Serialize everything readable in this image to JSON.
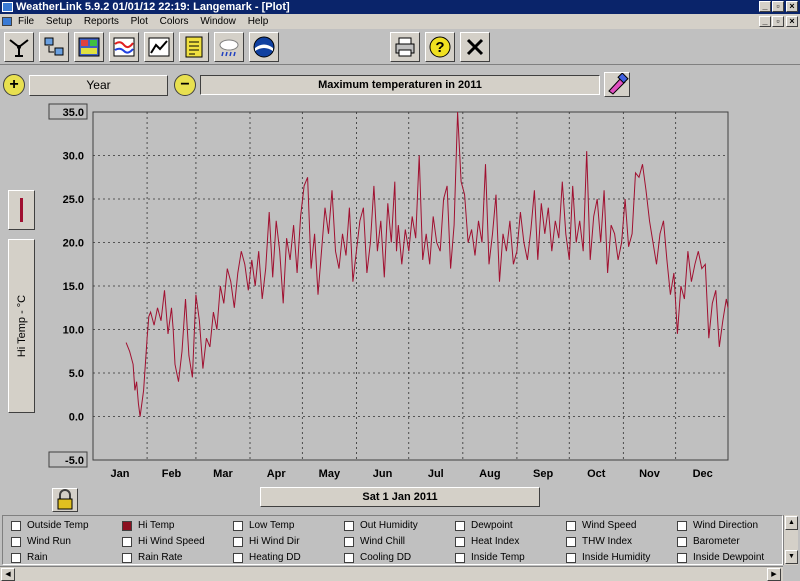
{
  "window": {
    "title": "WeatherLink 5.9.2  01/01/12  22:19: Langemark - [Plot]"
  },
  "menu": {
    "items": [
      "File",
      "Setup",
      "Reports",
      "Plot",
      "Colors",
      "Window",
      "Help"
    ]
  },
  "toolbar": {
    "icons": [
      "station-icon",
      "transfer-icon",
      "bulletin-icon",
      "strip-chart-icon",
      "plot-icon",
      "notes-icon",
      "forecast-icon",
      "noaa-icon",
      "print-icon",
      "help-icon",
      "close-icon"
    ]
  },
  "controls": {
    "period_label": "Year",
    "chart_title": "Maximum temperaturen in 2011",
    "axis_label": "Hi Temp - °C",
    "current_date": "Sat 1 Jan 2011"
  },
  "colors": {
    "series": "#a01030",
    "plot_bg": "#c0c0c0",
    "title_bar": "#0a246a"
  },
  "chart_data": {
    "type": "line",
    "title": "Maximum temperaturen in 2011",
    "ylabel": "Hi Temp - °C",
    "xlabel": "",
    "ylim": [
      -5,
      35
    ],
    "y_ticks": [
      "35.0",
      "30.0",
      "25.0",
      "20.0",
      "15.0",
      "10.0",
      "5.0",
      "0.0",
      "-5.0"
    ],
    "x_categories": [
      "Jan",
      "Feb",
      "Mar",
      "Apr",
      "May",
      "Jun",
      "Jul",
      "Aug",
      "Sep",
      "Oct",
      "Nov",
      "Dec"
    ],
    "grid": true,
    "series": [
      {
        "name": "Hi Temp",
        "color": "#a01030",
        "day_of_year": [
          20,
          22,
          24,
          25,
          26,
          27,
          28,
          30,
          32,
          33,
          34,
          36,
          38,
          40,
          42,
          44,
          46,
          47,
          48,
          50,
          52,
          54,
          56,
          58,
          60,
          62,
          64,
          66,
          68,
          70,
          72,
          74,
          76,
          78,
          80,
          82,
          84,
          86,
          88,
          90,
          92,
          94,
          96,
          98,
          100,
          102,
          104,
          106,
          108,
          110,
          112,
          114,
          116,
          118,
          120,
          122,
          124,
          126,
          128,
          130,
          132,
          134,
          136,
          138,
          140,
          142,
          144,
          146,
          148,
          150,
          152,
          154,
          156,
          158,
          160,
          162,
          164,
          166,
          168,
          170,
          172,
          174,
          175,
          176,
          178,
          180,
          182,
          184,
          186,
          188,
          190,
          192,
          194,
          196,
          198,
          200,
          202,
          204,
          206,
          208,
          210,
          212,
          214,
          216,
          218,
          220,
          222,
          224,
          226,
          228,
          230,
          232,
          234,
          236,
          238,
          240,
          242,
          244,
          246,
          248,
          250,
          252,
          254,
          256,
          258,
          260,
          262,
          264,
          266,
          268,
          270,
          272,
          274,
          276,
          278,
          280,
          282,
          284,
          286,
          288,
          290,
          292,
          294,
          296,
          298,
          300,
          302,
          304,
          306,
          308,
          310,
          312,
          314,
          316,
          318,
          320,
          322,
          324,
          326,
          328,
          330,
          332,
          334,
          336,
          338,
          340,
          342,
          344,
          346,
          348,
          350,
          352,
          354,
          356,
          358,
          360,
          362,
          364,
          365
        ],
        "values": [
          8.5,
          7.5,
          6,
          3,
          4,
          1.5,
          0,
          3,
          9,
          11.5,
          12,
          10.5,
          12.5,
          11,
          14.5,
          9.5,
          12.5,
          10,
          6,
          4,
          7.5,
          13.5,
          7,
          4.5,
          14,
          11,
          5.5,
          9,
          8,
          12,
          10,
          15,
          13,
          17,
          15.5,
          12.5,
          16.5,
          19,
          17.5,
          14.5,
          18,
          15,
          19,
          13.5,
          17,
          23.5,
          16,
          22.5,
          19,
          13,
          20.5,
          18,
          22,
          16.5,
          23,
          26.5,
          27.5,
          17,
          21,
          14,
          19,
          24,
          21,
          26,
          19,
          17,
          21,
          18.5,
          24,
          15.5,
          19,
          22.5,
          24,
          16.5,
          20,
          26.5,
          19,
          22.5,
          16,
          24.5,
          20,
          27,
          19,
          22,
          17.5,
          21.5,
          19,
          23,
          20.5,
          30,
          18,
          21,
          17.5,
          23,
          20,
          19,
          25,
          26.5,
          17,
          22,
          35,
          27,
          25.5,
          20,
          21.5,
          18.5,
          22.5,
          20,
          29,
          17.5,
          21,
          25.5,
          15.5,
          21,
          19,
          22.5,
          17.5,
          19,
          23.5,
          20,
          18,
          21.5,
          26,
          18,
          24.5,
          21,
          24,
          19,
          22.5,
          20.5,
          27,
          21,
          18,
          26.5,
          20,
          22.5,
          19,
          30.5,
          18,
          23,
          25,
          20,
          26,
          16.5,
          22,
          21,
          18,
          20,
          25,
          19.5,
          21,
          28,
          27.5,
          29,
          26,
          22.5,
          20,
          17.5,
          21,
          22.5,
          18,
          14,
          16.5,
          9.5,
          15,
          13.5,
          19,
          15.5,
          17.5,
          19,
          17,
          17.5,
          9,
          13,
          14.5,
          8,
          11,
          13.5,
          12.5,
          10,
          13.5,
          11,
          8.5,
          3.5,
          10,
          7.5,
          9,
          12,
          11,
          10,
          14,
          11.5,
          13,
          8.5,
          10,
          10.5,
          9,
          13,
          11,
          6,
          10.5,
          12,
          8,
          12.5,
          11,
          8.5,
          13.5,
          10,
          7.5,
          14
        ]
      }
    ]
  },
  "legend": {
    "items": [
      {
        "label": "Outside Temp",
        "checked": false
      },
      {
        "label": "Hi Temp",
        "checked": true
      },
      {
        "label": "Low Temp",
        "checked": false
      },
      {
        "label": "Out Humidity",
        "checked": false
      },
      {
        "label": "Dewpoint",
        "checked": false
      },
      {
        "label": "Wind Speed",
        "checked": false
      },
      {
        "label": "Wind Direction",
        "checked": false
      },
      {
        "label": "Wind Run",
        "checked": false
      },
      {
        "label": "Hi Wind Speed",
        "checked": false
      },
      {
        "label": "Hi Wind Dir",
        "checked": false
      },
      {
        "label": "Wind Chill",
        "checked": false
      },
      {
        "label": "Heat Index",
        "checked": false
      },
      {
        "label": "THW Index",
        "checked": false
      },
      {
        "label": "Barometer",
        "checked": false
      },
      {
        "label": "Rain",
        "checked": false
      },
      {
        "label": "Rain Rate",
        "checked": false
      },
      {
        "label": "Heating DD",
        "checked": false
      },
      {
        "label": "Cooling DD",
        "checked": false
      },
      {
        "label": "Inside Temp",
        "checked": false
      },
      {
        "label": "Inside Humidity",
        "checked": false
      },
      {
        "label": "Inside Dewpoint",
        "checked": false
      }
    ]
  }
}
